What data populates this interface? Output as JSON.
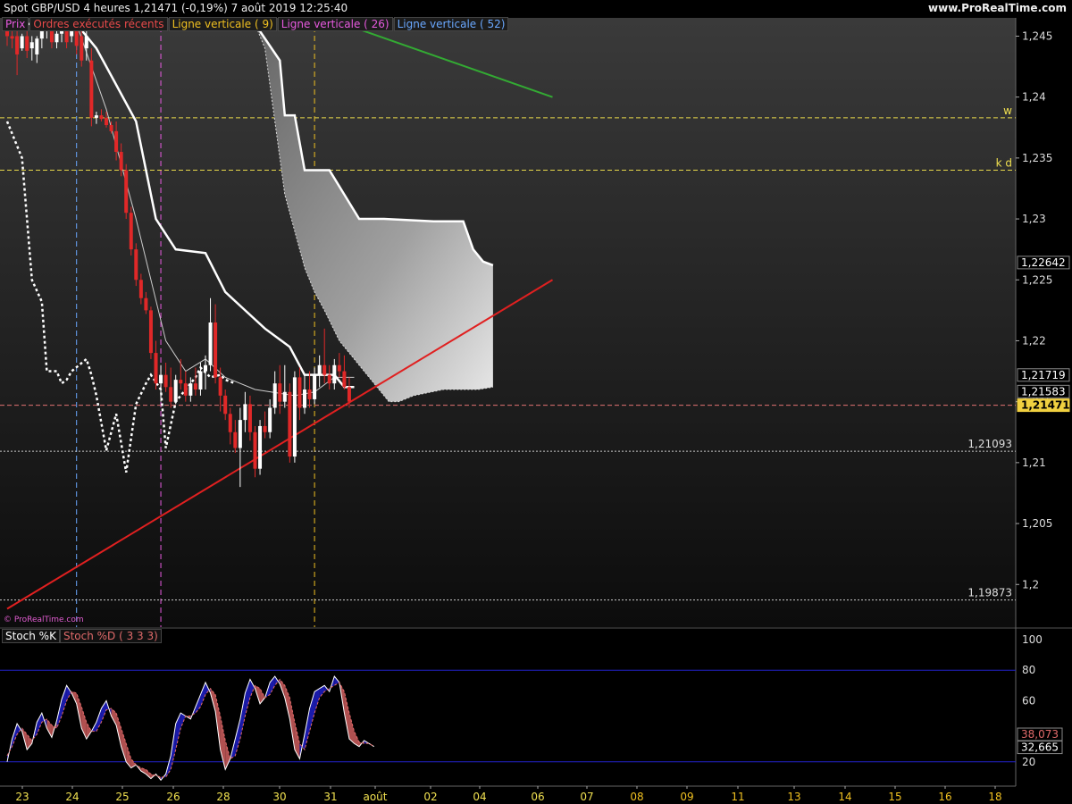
{
  "header": {
    "title": "Spot GBP/USD   4 heures   1,21471 (-0,19%)   7 août 2019 12:25:40",
    "site": "www.ProRealTime.com"
  },
  "legend": [
    {
      "label": "Prix",
      "color": "#e85ae0"
    },
    {
      "label": "Ordres exécutés récents",
      "color": "#e84a4a"
    },
    {
      "label": "Ligne verticale ( 9)",
      "color": "#f0c020"
    },
    {
      "label": "Ligne verticale ( 26)",
      "color": "#e85ae0"
    },
    {
      "label": "Ligne verticale ( 52)",
      "color": "#6aa8ff"
    }
  ],
  "watermark": "© ProRealTime.com",
  "stoch_legend": [
    {
      "label": "Stoch %K",
      "color": "#ffffff"
    },
    {
      "label": "Stoch %D ( 3 3 3)",
      "color": "#e06a6a"
    }
  ],
  "chart_data": {
    "type": "candlestick",
    "title": "Spot GBP/USD 4 heures",
    "ylim": [
      1.1965,
      1.2465
    ],
    "y_ticks": [
      "1,245",
      "1,24",
      "1,235",
      "1,23",
      "1,225",
      "1,22",
      "1,215",
      "1,21",
      "1,205",
      "1,2"
    ],
    "x_ticks": [
      "23",
      "24",
      "25",
      "26",
      "28",
      "30",
      "31",
      "août",
      "02",
      "04",
      "06",
      "07",
      "08",
      "09",
      "11",
      "13",
      "14",
      "15",
      "16",
      "18"
    ],
    "candles": [
      [
        1.246,
        1.2465,
        1.2442,
        1.245
      ],
      [
        1.245,
        1.2458,
        1.244,
        1.2448
      ],
      [
        1.245,
        1.2455,
        1.2418,
        1.2435
      ],
      [
        1.244,
        1.2452,
        1.2438,
        1.245
      ],
      [
        1.245,
        1.246,
        1.2432,
        1.2438
      ],
      [
        1.244,
        1.245,
        1.243,
        1.2445
      ],
      [
        1.2435,
        1.245,
        1.2428,
        1.2448
      ],
      [
        1.2448,
        1.246,
        1.244,
        1.2455
      ],
      [
        1.2455,
        1.2462,
        1.2448,
        1.2458
      ],
      [
        1.2458,
        1.2462,
        1.244,
        1.2445
      ],
      [
        1.2445,
        1.2458,
        1.244,
        1.2452
      ],
      [
        1.2452,
        1.246,
        1.2445,
        1.2456
      ],
      [
        1.2456,
        1.2462,
        1.244,
        1.2445
      ],
      [
        1.245,
        1.2465,
        1.2445,
        1.246
      ],
      [
        1.246,
        1.2465,
        1.2435,
        1.2442
      ],
      [
        1.245,
        1.2462,
        1.2425,
        1.243
      ],
      [
        1.244,
        1.2458,
        1.243,
        1.245
      ],
      [
        1.243,
        1.244,
        1.2376,
        1.2383
      ],
      [
        1.2383,
        1.2388,
        1.2378,
        1.2385
      ],
      [
        1.2385,
        1.239,
        1.238,
        1.2382
      ],
      [
        1.2383,
        1.2388,
        1.2375,
        1.2377
      ],
      [
        1.2377,
        1.238,
        1.237,
        1.2372
      ],
      [
        1.2372,
        1.238,
        1.2348,
        1.2355
      ],
      [
        1.2355,
        1.2362,
        1.2335,
        1.234
      ],
      [
        1.234,
        1.2345,
        1.23,
        1.2305
      ],
      [
        1.2305,
        1.231,
        1.227,
        1.2275
      ],
      [
        1.2275,
        1.228,
        1.2245,
        1.225
      ],
      [
        1.225,
        1.2255,
        1.223,
        1.2235
      ],
      [
        1.2235,
        1.224,
        1.2222,
        1.2225
      ],
      [
        1.2225,
        1.2228,
        1.2185,
        1.219
      ],
      [
        1.219,
        1.22,
        1.216,
        1.2165
      ],
      [
        1.2165,
        1.218,
        1.215,
        1.2172
      ],
      [
        1.2172,
        1.2182,
        1.2158,
        1.2162
      ],
      [
        1.2162,
        1.2178,
        1.2145,
        1.215
      ],
      [
        1.215,
        1.2172,
        1.2148,
        1.2168
      ],
      [
        1.2168,
        1.2185,
        1.216,
        1.2165
      ],
      [
        1.2165,
        1.2175,
        1.215,
        1.2155
      ],
      [
        1.2155,
        1.217,
        1.215,
        1.2165
      ],
      [
        1.2165,
        1.2178,
        1.2155,
        1.216
      ],
      [
        1.216,
        1.2182,
        1.2155,
        1.2175
      ],
      [
        1.2175,
        1.2188,
        1.216,
        1.218
      ],
      [
        1.218,
        1.2235,
        1.2175,
        1.2215
      ],
      [
        1.2215,
        1.223,
        1.2165,
        1.217
      ],
      [
        1.217,
        1.2178,
        1.2142,
        1.2155
      ],
      [
        1.2155,
        1.216,
        1.2135,
        1.214
      ],
      [
        1.214,
        1.2145,
        1.2115,
        1.2125
      ],
      [
        1.2125,
        1.2135,
        1.2108,
        1.2112
      ],
      [
        1.2112,
        1.2145,
        1.208,
        1.2135
      ],
      [
        1.2135,
        1.2158,
        1.2125,
        1.2148
      ],
      [
        1.2148,
        1.2155,
        1.2118,
        1.2125
      ],
      [
        1.2125,
        1.213,
        1.2088,
        1.2095
      ],
      [
        1.2095,
        1.2135,
        1.209,
        1.213
      ],
      [
        1.213,
        1.2142,
        1.212,
        1.2125
      ],
      [
        1.2125,
        1.2152,
        1.212,
        1.2145
      ],
      [
        1.2145,
        1.2175,
        1.214,
        1.2165
      ],
      [
        1.2165,
        1.218,
        1.214,
        1.215
      ],
      [
        1.215,
        1.218,
        1.2145,
        1.2158
      ],
      [
        1.2158,
        1.2165,
        1.21,
        1.2105
      ],
      [
        1.2105,
        1.2175,
        1.21,
        1.217
      ],
      [
        1.217,
        1.2178,
        1.2135,
        1.2145
      ],
      [
        1.2145,
        1.2172,
        1.214,
        1.216
      ],
      [
        1.216,
        1.2175,
        1.2145,
        1.2152
      ],
      [
        1.2152,
        1.2178,
        1.2148,
        1.2172
      ],
      [
        1.2172,
        1.2188,
        1.2162,
        1.218
      ],
      [
        1.218,
        1.221,
        1.2165,
        1.2172
      ],
      [
        1.2172,
        1.218,
        1.216,
        1.2165
      ],
      [
        1.2165,
        1.2185,
        1.216,
        1.218
      ],
      [
        1.218,
        1.219,
        1.217,
        1.2175
      ],
      [
        1.2175,
        1.2188,
        1.216,
        1.2162
      ],
      [
        1.2162,
        1.217,
        1.2145,
        1.215
      ]
    ],
    "ichimoku": {
      "tenkan": [
        [
          0,
          1.246
        ],
        [
          14,
          1.246
        ],
        [
          18,
          1.244
        ],
        [
          22,
          1.241
        ],
        [
          26,
          1.238
        ],
        [
          30,
          1.23
        ],
        [
          34,
          1.2275
        ],
        [
          40,
          1.2272
        ],
        [
          44,
          1.224
        ],
        [
          48,
          1.2225
        ],
        [
          52,
          1.221
        ],
        [
          57,
          1.2195
        ],
        [
          60,
          1.2172
        ],
        [
          66,
          1.2172
        ],
        [
          68,
          1.2162
        ],
        [
          70,
          1.2162
        ]
      ],
      "kijun": [
        [
          14,
          1.246
        ],
        [
          20,
          1.239
        ],
        [
          26,
          1.23
        ],
        [
          32,
          1.22
        ],
        [
          36,
          1.2175
        ],
        [
          40,
          1.2185
        ],
        [
          44,
          1.217
        ],
        [
          50,
          1.216
        ],
        [
          58,
          1.2155
        ],
        [
          62,
          1.2158
        ],
        [
          66,
          1.217
        ],
        [
          70,
          1.217
        ]
      ],
      "cloud_upper": [
        [
          50,
          1.246
        ],
        [
          55,
          1.243
        ],
        [
          56,
          1.2385
        ],
        [
          58,
          1.2385
        ],
        [
          60,
          1.234
        ],
        [
          65,
          1.234
        ],
        [
          68,
          1.232
        ],
        [
          71,
          1.23
        ],
        [
          72,
          1.23
        ],
        [
          76,
          1.23
        ],
        [
          86,
          1.2298
        ],
        [
          92,
          1.2298
        ],
        [
          94,
          1.2275
        ],
        [
          96,
          1.2265
        ],
        [
          98,
          1.2262
        ]
      ],
      "cloud_lower": [
        [
          50,
          1.246
        ],
        [
          52,
          1.244
        ],
        [
          56,
          1.232
        ],
        [
          58,
          1.229
        ],
        [
          60,
          1.226
        ],
        [
          62,
          1.224
        ],
        [
          64,
          1.2225
        ],
        [
          67,
          1.22
        ],
        [
          70,
          1.2185
        ],
        [
          73,
          1.217
        ],
        [
          77,
          1.215
        ],
        [
          79,
          1.215
        ],
        [
          82,
          1.2155
        ],
        [
          88,
          1.216
        ],
        [
          92,
          1.216
        ],
        [
          95,
          1.216
        ],
        [
          98,
          1.2162
        ]
      ],
      "chikou": [
        [
          0,
          1.238
        ],
        [
          3,
          1.235
        ],
        [
          4,
          1.23
        ],
        [
          5,
          1.225
        ],
        [
          7,
          1.2232
        ],
        [
          8,
          1.2175
        ],
        [
          10,
          1.2175
        ],
        [
          11,
          1.2165
        ],
        [
          12,
          1.2168
        ],
        [
          13,
          1.2175
        ],
        [
          16,
          1.2185
        ],
        [
          17,
          1.2172
        ],
        [
          18,
          1.2155
        ],
        [
          20,
          1.211
        ],
        [
          22,
          1.214
        ],
        [
          24,
          1.2092
        ],
        [
          26,
          1.2148
        ],
        [
          28,
          1.2165
        ],
        [
          29,
          1.2172
        ],
        [
          31,
          1.216
        ],
        [
          32,
          1.2112
        ],
        [
          34,
          1.215
        ],
        [
          36,
          1.216
        ],
        [
          38,
          1.217
        ],
        [
          39,
          1.2178
        ],
        [
          41,
          1.217
        ],
        [
          43,
          1.2172
        ],
        [
          44,
          1.2168
        ],
        [
          46,
          1.2165
        ]
      ]
    },
    "hlines": [
      {
        "value": 1.2383,
        "label": "w",
        "style": "dash",
        "color": "#e8d84a"
      },
      {
        "value": 1.234,
        "label": "k d",
        "style": "dash",
        "color": "#e8d84a"
      },
      {
        "value": 1.21093,
        "label": "1,21093",
        "style": "dot",
        "color": "#cccccc"
      },
      {
        "value": 1.19873,
        "label": "1,19873",
        "style": "dot",
        "color": "#cccccc"
      },
      {
        "value": 1.21471,
        "label": "",
        "style": "dash",
        "color": "#e07070"
      }
    ],
    "price_labels": [
      {
        "value": 1.22642,
        "label": "1,22642",
        "highlight": false
      },
      {
        "value": 1.21719,
        "label": "1,21719",
        "highlight": false
      },
      {
        "value": 1.21583,
        "label": "1,21583",
        "highlight": false
      },
      {
        "value": 1.21471,
        "label": "1,21471",
        "highlight": true
      }
    ],
    "trendlines": [
      {
        "color": "#e02020",
        "p1": [
          0,
          1.198
        ],
        "p2": [
          110,
          1.225
        ]
      },
      {
        "color": "#33aa33",
        "p1": [
          63,
          1.2467
        ],
        "p2": [
          110,
          1.24
        ]
      }
    ],
    "vlines": [
      {
        "index": 14,
        "color": "#6aa8ff"
      },
      {
        "index": 31,
        "color": "#e85ae0"
      },
      {
        "index": 62,
        "color": "#f0c020"
      }
    ],
    "stoch": {
      "ylim": [
        0,
        100
      ],
      "y_ticks": [
        "100",
        "80",
        "60",
        "20"
      ],
      "levels": [
        80,
        20
      ],
      "k": [
        20,
        35,
        45,
        40,
        28,
        32,
        46,
        52,
        42,
        36,
        47,
        61,
        70,
        65,
        58,
        42,
        35,
        40,
        46,
        55,
        60,
        50,
        44,
        30,
        20,
        16,
        18,
        14,
        12,
        9,
        12,
        8,
        12,
        24,
        45,
        52,
        50,
        48,
        56,
        64,
        72,
        65,
        53,
        28,
        15,
        22,
        35,
        48,
        65,
        74,
        68,
        58,
        62,
        72,
        76,
        71,
        62,
        48,
        28,
        22,
        38,
        55,
        66,
        68,
        70,
        66,
        76,
        72,
        52,
        35,
        32,
        30,
        34,
        32,
        30
      ],
      "d": [
        24,
        30,
        38,
        42,
        38,
        34,
        38,
        46,
        48,
        44,
        42,
        50,
        60,
        66,
        65,
        56,
        46,
        40,
        40,
        46,
        54,
        55,
        52,
        42,
        32,
        22,
        18,
        16,
        15,
        12,
        11,
        10,
        10,
        15,
        28,
        42,
        50,
        50,
        52,
        56,
        64,
        68,
        64,
        50,
        34,
        22,
        24,
        35,
        50,
        62,
        70,
        68,
        62,
        64,
        70,
        74,
        70,
        62,
        46,
        32,
        28,
        40,
        52,
        62,
        66,
        68,
        70,
        72,
        66,
        52,
        40,
        33,
        32,
        32,
        30
      ],
      "k_label": "38,073",
      "d_label": "32,665"
    }
  }
}
